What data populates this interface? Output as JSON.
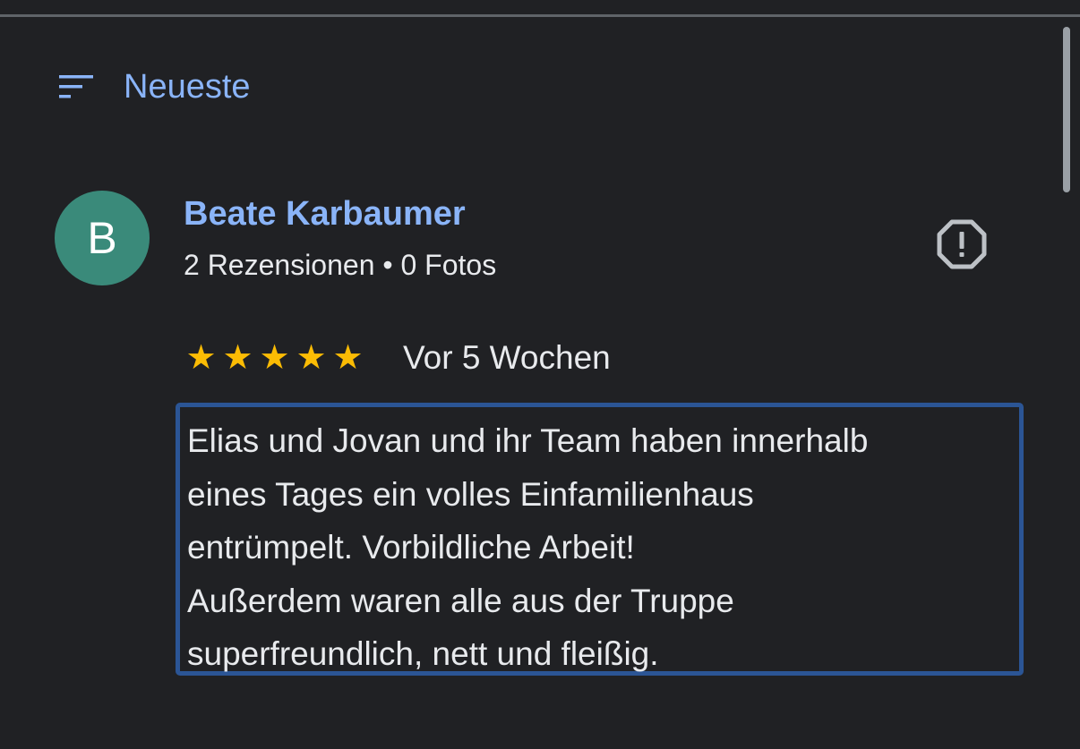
{
  "sort": {
    "label": "Neueste",
    "icon": "sort-icon"
  },
  "review": {
    "author": {
      "initial": "B",
      "avatar_color": "#3a8a7a",
      "name": "Beate Karbaumer",
      "meta": "2 Rezensionen • 0 Fotos"
    },
    "rating": {
      "stars": 5,
      "max": 5,
      "star_color": "#fbbc04",
      "glyph": "★"
    },
    "date": "Vor 5 Wochen",
    "text_lines": [
      "Elias und Jovan und ihr Team haben innerhalb",
      "eines Tages ein volles Einfamilienhaus",
      "entrümpelt. Vorbildliche Arbeit!",
      "Außerdem waren alle aus der Truppe",
      "superfreundlich, nett und fleißig."
    ],
    "report_icon": "report-icon"
  },
  "theme": {
    "background": "#202124",
    "accent": "#8ab4f8",
    "highlight_border": "#2b5595"
  }
}
